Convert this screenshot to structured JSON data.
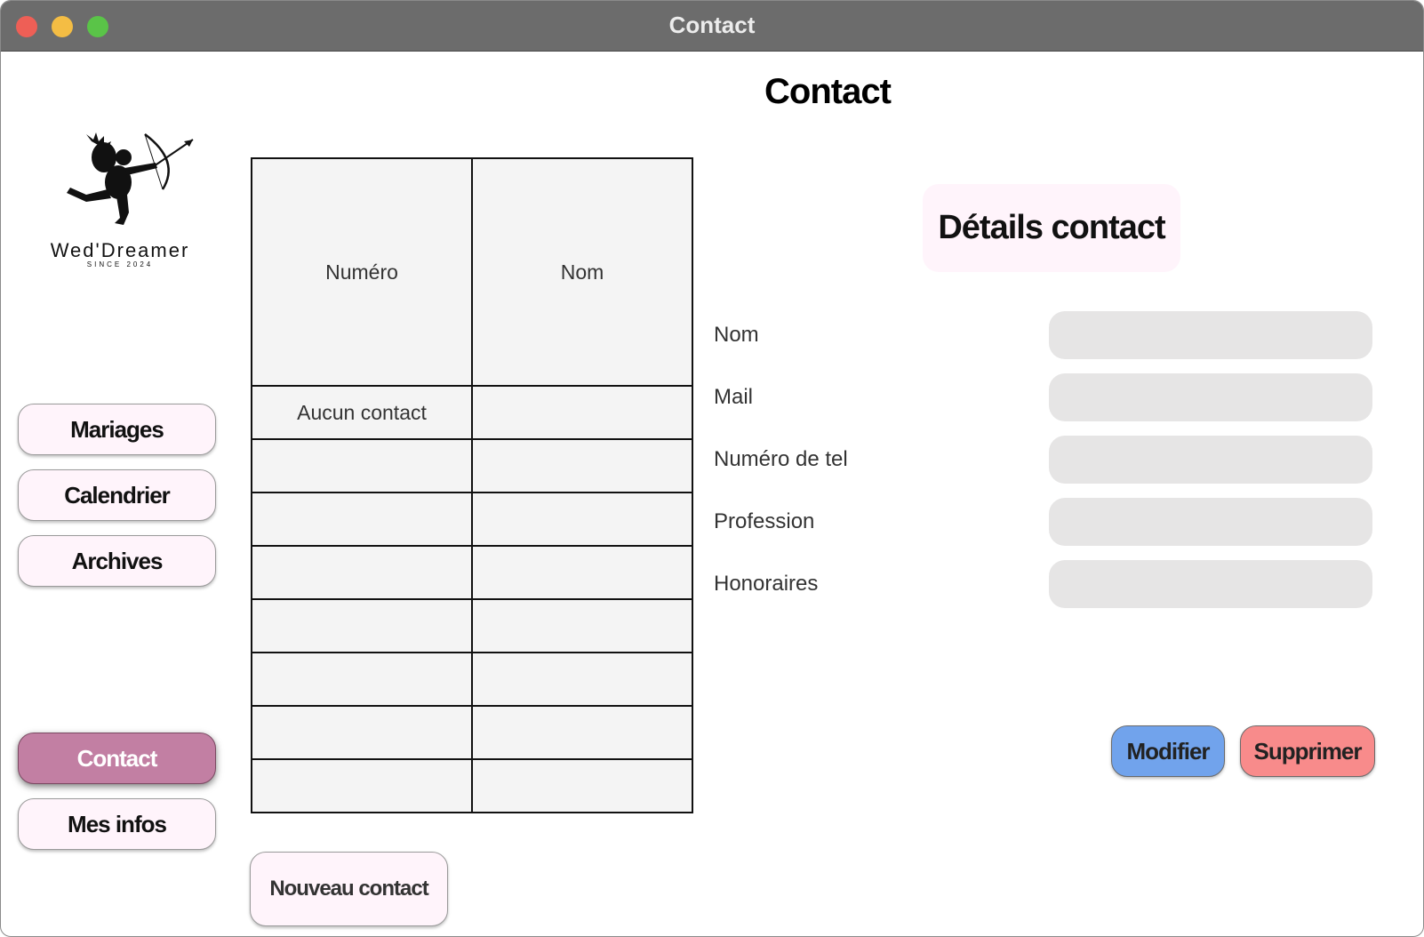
{
  "window": {
    "title": "Contact"
  },
  "page": {
    "title": "Contact"
  },
  "logo": {
    "brand": "Wed'Dreamer",
    "since": "SINCE 2024"
  },
  "nav": {
    "items": [
      {
        "label": "Mariages"
      },
      {
        "label": "Calendrier"
      },
      {
        "label": "Archives"
      },
      {
        "label": "Contact",
        "active": true
      },
      {
        "label": "Mes infos"
      }
    ]
  },
  "table": {
    "headers": [
      "Numéro",
      "Nom"
    ],
    "rows": [
      [
        "Aucun contact",
        ""
      ],
      [
        "",
        ""
      ],
      [
        "",
        ""
      ],
      [
        "",
        ""
      ],
      [
        "",
        ""
      ],
      [
        "",
        ""
      ],
      [
        "",
        ""
      ],
      [
        "",
        ""
      ]
    ]
  },
  "new_contact_label": "Nouveau contact",
  "details": {
    "title": "Détails contact",
    "fields": [
      {
        "label": "Nom",
        "value": ""
      },
      {
        "label": "Mail",
        "value": ""
      },
      {
        "label": "Numéro de tel",
        "value": ""
      },
      {
        "label": "Profession",
        "value": ""
      },
      {
        "label": "Honoraires",
        "value": ""
      }
    ],
    "edit_label": "Modifier",
    "delete_label": "Supprimer"
  },
  "colors": {
    "accent": "#c27fa3",
    "button_bg": "#fff4fb",
    "edit": "#71a3ec",
    "delete": "#f88b8b",
    "titlebar": "#6c6c6c"
  }
}
